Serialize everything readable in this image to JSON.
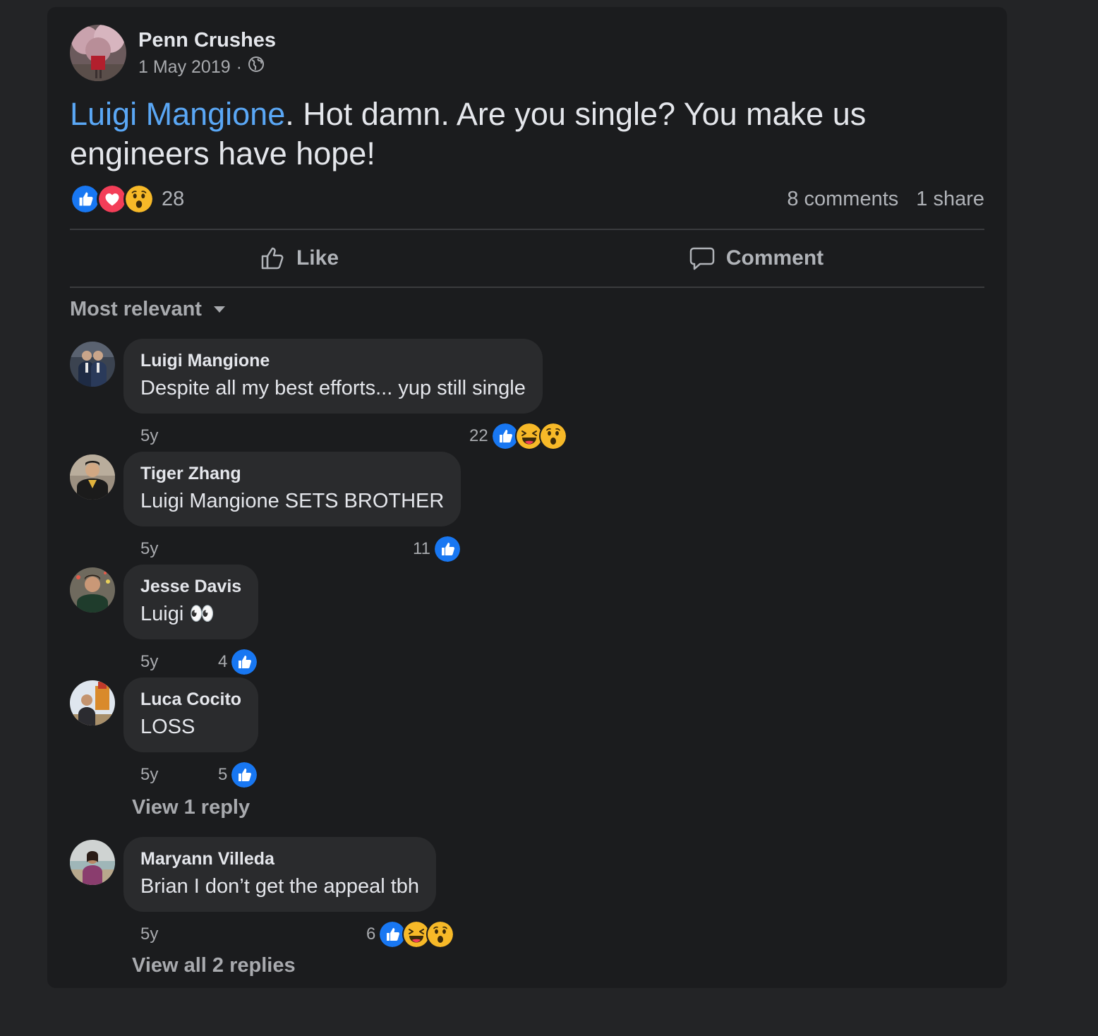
{
  "post": {
    "page_name": "Penn Crushes",
    "date": "1 May 2019",
    "separator": "·",
    "audience_icon": "globe-icon",
    "mention": "Luigi Mangione",
    "text_line1": ". Hot damn. Are you single? You make us",
    "text_line2": "engineers have hope!",
    "reaction_icons": [
      "like",
      "love",
      "wow"
    ],
    "reaction_count": "28",
    "comments_count": "8 comments",
    "shares_count": "1 share"
  },
  "actions": {
    "like_label": "Like",
    "comment_label": "Comment"
  },
  "sort": {
    "label": "Most relevant"
  },
  "comments": [
    {
      "author": "Luigi Mangione",
      "text": "Despite all my best efforts... yup still single",
      "time": "5y",
      "reaction_count": "22",
      "reactions": [
        "like",
        "haha",
        "wow"
      ]
    },
    {
      "author": "Tiger Zhang",
      "text": "Luigi Mangione SETS BROTHER",
      "time": "5y",
      "reaction_count": "11",
      "reactions": [
        "like"
      ]
    },
    {
      "author": "Jesse Davis",
      "text": "Luigi 👀",
      "time": "5y",
      "reaction_count": "4",
      "reactions": [
        "like"
      ]
    },
    {
      "author": "Luca Cocito",
      "text": "LOSS",
      "time": "5y",
      "reaction_count": "5",
      "reactions": [
        "like"
      ],
      "replies_label": "View 1 reply"
    },
    {
      "author": "Maryann Villeda",
      "text": "Brian I don’t get the appeal tbh",
      "time": "5y",
      "reaction_count": "6",
      "reactions": [
        "like",
        "haha",
        "wow"
      ],
      "replies_label": "View all 2 replies"
    }
  ],
  "colors": {
    "background": "#232426",
    "card": "#1b1c1e",
    "bubble": "#2a2b2d",
    "mention": "#5aa7f5",
    "like_blue": "#1877f2",
    "love_red": "#f33e58",
    "emoji_yellow": "#f7b928"
  }
}
